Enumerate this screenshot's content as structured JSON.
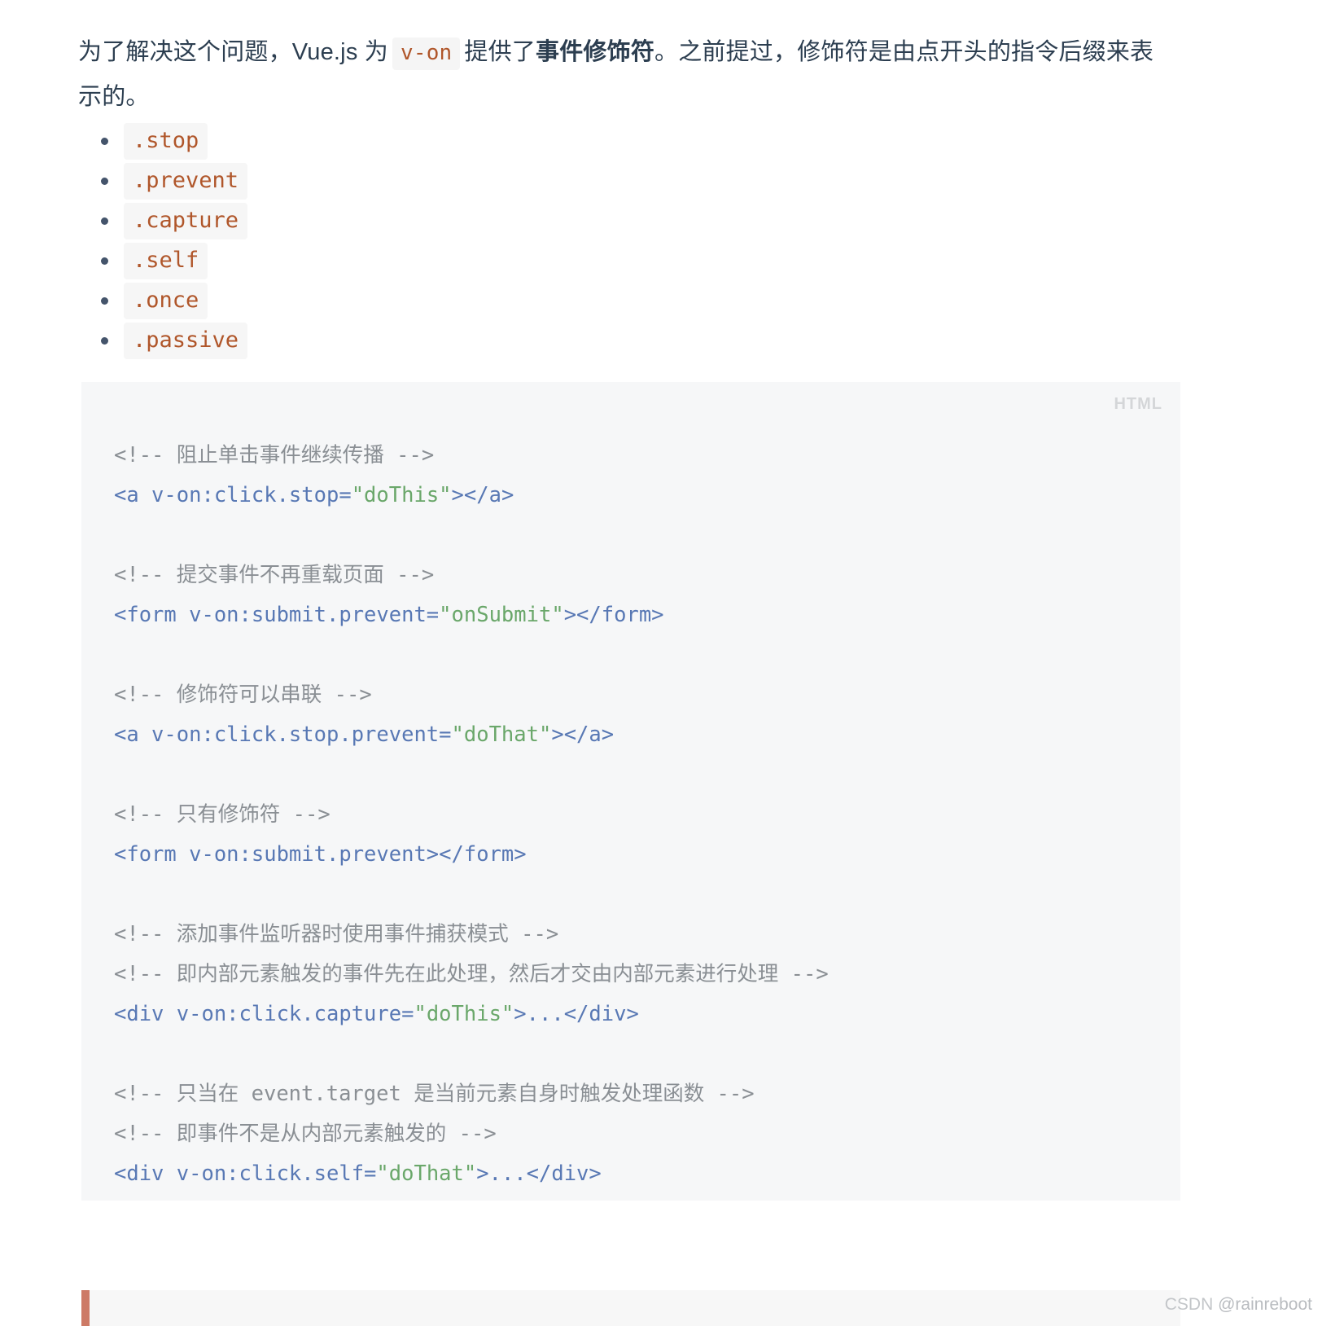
{
  "intro": {
    "part1": "为了解决这个问题，Vue.js 为",
    "inline_code": "v-on",
    "part2": "提供了",
    "bold": "事件修饰符",
    "part3": "。之前提过，修饰符是由点开头的指令后缀来表示的。"
  },
  "modifier_list": [
    {
      "label": ".stop"
    },
    {
      "label": ".prevent"
    },
    {
      "label": ".capture"
    },
    {
      "label": ".self"
    },
    {
      "label": ".once"
    },
    {
      "label": ".passive"
    }
  ],
  "code_block": {
    "language_label": "HTML",
    "lines": [
      {
        "type": "comment",
        "text": "<!-- 阻止单击事件继续传播 -->"
      },
      {
        "type": "code",
        "tag_open": "<a v-on:click.stop=",
        "string": "\"doThis\"",
        "tag_close": "></a>"
      },
      {
        "type": "blank",
        "text": ""
      },
      {
        "type": "comment",
        "text": "<!-- 提交事件不再重载页面 -->"
      },
      {
        "type": "code",
        "tag_open": "<form v-on:submit.prevent=",
        "string": "\"onSubmit\"",
        "tag_close": "></form>"
      },
      {
        "type": "blank",
        "text": ""
      },
      {
        "type": "comment",
        "text": "<!-- 修饰符可以串联 -->"
      },
      {
        "type": "code",
        "tag_open": "<a v-on:click.stop.prevent=",
        "string": "\"doThat\"",
        "tag_close": "></a>"
      },
      {
        "type": "blank",
        "text": ""
      },
      {
        "type": "comment",
        "text": "<!-- 只有修饰符 -->"
      },
      {
        "type": "code",
        "tag_open": "<form v-on:submit.prevent></form>",
        "string": "",
        "tag_close": ""
      },
      {
        "type": "blank",
        "text": ""
      },
      {
        "type": "comment",
        "text": "<!-- 添加事件监听器时使用事件捕获模式 -->"
      },
      {
        "type": "comment",
        "text": "<!-- 即内部元素触发的事件先在此处理，然后才交由内部元素进行处理 -->"
      },
      {
        "type": "code",
        "tag_open": "<div v-on:click.capture=",
        "string": "\"doThis\"",
        "tag_close": ">...</div>"
      },
      {
        "type": "blank",
        "text": ""
      },
      {
        "type": "comment",
        "text": "<!-- 只当在 event.target 是当前元素自身时触发处理函数 -->"
      },
      {
        "type": "comment",
        "text": "<!-- 即事件不是从内部元素触发的 -->"
      },
      {
        "type": "code",
        "tag_open": "<div v-on:click.self=",
        "string": "\"doThat\"",
        "tag_close": ">...</div>"
      }
    ]
  },
  "watermark": {
    "brand": "CSDN",
    "user": "@rainreboot"
  },
  "colors": {
    "text": "#2c3e50",
    "inline_code_text": "#b0562a",
    "inline_code_bg": "#f5f5f5",
    "code_bg": "#f6f7f8",
    "comment": "#8a8f94",
    "tag": "#5878b4",
    "string": "#6aa76a",
    "quote_bar": "#cd7a66",
    "lang_label": "#d4d6d8"
  }
}
